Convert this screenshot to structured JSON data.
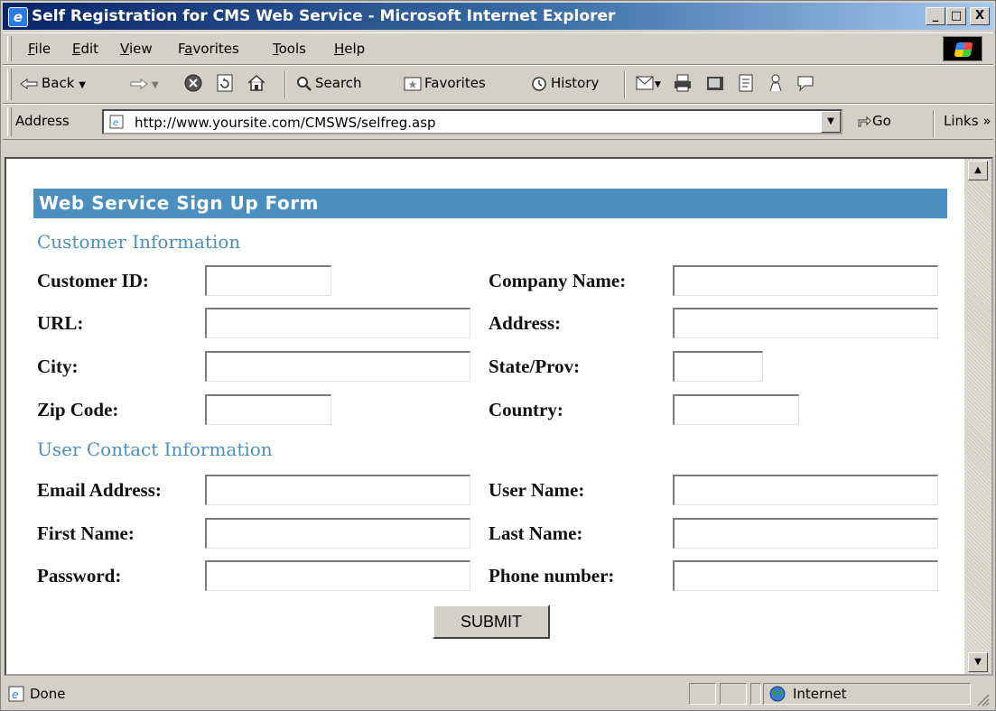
{
  "window": {
    "title": "Self Registration for CMS Web Service - Microsoft Internet Explorer",
    "minimize": "_",
    "maximize": "□",
    "close": "X"
  },
  "menubar": {
    "items": [
      {
        "pre": "",
        "u": "F",
        "post": "ile"
      },
      {
        "pre": "",
        "u": "E",
        "post": "dit"
      },
      {
        "pre": "",
        "u": "V",
        "post": "iew"
      },
      {
        "pre": "F",
        "u": "a",
        "post": "vorites"
      },
      {
        "pre": "",
        "u": "T",
        "post": "ools"
      },
      {
        "pre": "",
        "u": "H",
        "post": "elp"
      }
    ]
  },
  "toolbar": {
    "back": "Back",
    "search": "Search",
    "favorites": "Favorites",
    "history": "History"
  },
  "addressbar": {
    "label": "Address",
    "url": "http://www.yoursite.com/CMSWS/selfreg.asp",
    "go": "Go",
    "links": "Links"
  },
  "form": {
    "header": "Web Service Sign Up Form",
    "section_customer": "Customer Information",
    "section_contact": "User Contact Information",
    "labels": {
      "customer_id": "Customer ID:",
      "company_name": "Company Name:",
      "url": "URL:",
      "address": "Address:",
      "city": "City:",
      "state": "State/Prov:",
      "zip": "Zip Code:",
      "country": "Country:",
      "email": "Email Address:",
      "user_name": "User Name:",
      "first_name": "First Name:",
      "last_name": "Last Name:",
      "password": "Password:",
      "phone": "Phone number:"
    },
    "values": {
      "customer_id": "",
      "company_name": "",
      "url": "",
      "address": "",
      "city": "",
      "state": "",
      "zip": "",
      "country": "",
      "email": "",
      "user_name": "",
      "first_name": "",
      "last_name": "",
      "password": "",
      "phone": ""
    },
    "submit": "SUBMIT"
  },
  "statusbar": {
    "status": "Done",
    "zone": "Internet"
  },
  "colors": {
    "header_bg": "#4b8fc0",
    "section_title": "#4b8fc0",
    "titlebar_start": "#0a246a"
  },
  "icons": [
    "ie-page-icon",
    "back-arrow-icon",
    "forward-arrow-icon",
    "stop-icon",
    "refresh-icon",
    "home-icon",
    "search-icon",
    "favorites-icon",
    "history-icon",
    "mail-icon",
    "print-icon",
    "edit-icon",
    "discuss-icon",
    "messenger-icon",
    "go-arrow-icon",
    "globe-icon"
  ]
}
